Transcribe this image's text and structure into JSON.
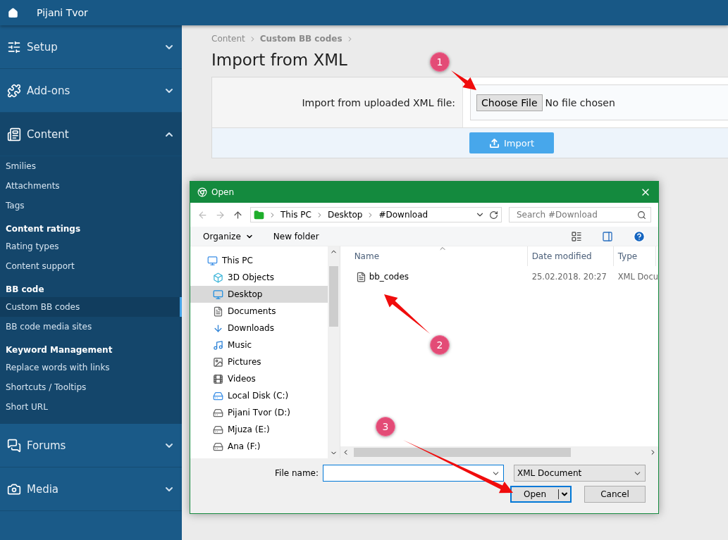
{
  "topbar": {
    "title": "Pijani Tvor"
  },
  "sidebar": {
    "sections": [
      {
        "label": "Setup",
        "expanded": false
      },
      {
        "label": "Add-ons",
        "expanded": false
      },
      {
        "label": "Content",
        "expanded": true,
        "groups": [
          {
            "items": [
              {
                "label": "Smilies",
                "selected": false
              },
              {
                "label": "Attachments",
                "selected": false
              },
              {
                "label": "Tags",
                "selected": false
              }
            ]
          },
          {
            "heading": "Content ratings",
            "items": [
              {
                "label": "Rating types",
                "selected": false
              },
              {
                "label": "Content support",
                "selected": false
              }
            ]
          },
          {
            "heading": "BB code",
            "items": [
              {
                "label": "Custom BB codes",
                "selected": true
              },
              {
                "label": "BB code media sites",
                "selected": false
              }
            ]
          },
          {
            "heading": "Keyword Management",
            "items": [
              {
                "label": "Replace words with links",
                "selected": false
              },
              {
                "label": "Shortcuts / Tooltips",
                "selected": false
              },
              {
                "label": "Short URL",
                "selected": false
              }
            ]
          }
        ]
      },
      {
        "label": "Forums",
        "expanded": false
      },
      {
        "label": "Media",
        "expanded": false
      }
    ]
  },
  "breadcrumb": [
    "Content",
    "Custom BB codes"
  ],
  "page_title": "Import from XML",
  "form": {
    "label": "Import from uploaded XML file:",
    "choose_button": "Choose File",
    "file_status": "No file chosen",
    "submit": "Import"
  },
  "dialog": {
    "title": "Open",
    "path": [
      "This PC",
      "Desktop",
      "#Download"
    ],
    "search_placeholder": "Search #Download",
    "toolbar": [
      "Organize",
      "New folder"
    ],
    "nav": [
      {
        "label": "This PC",
        "selected": false,
        "children": [
          {
            "label": "3D Objects",
            "selected": false
          },
          {
            "label": "Desktop",
            "selected": true
          },
          {
            "label": "Documents",
            "selected": false
          },
          {
            "label": "Downloads",
            "selected": false
          },
          {
            "label": "Music",
            "selected": false
          },
          {
            "label": "Pictures",
            "selected": false
          },
          {
            "label": "Videos",
            "selected": false
          },
          {
            "label": "Local Disk (C:)",
            "selected": false
          },
          {
            "label": "Pijani Tvor (D:)",
            "selected": false
          },
          {
            "label": "Mjuza (E:)",
            "selected": false
          },
          {
            "label": "Ana (F:)",
            "selected": false
          }
        ]
      }
    ],
    "columns": [
      "Name",
      "Date modified",
      "Type"
    ],
    "files": [
      {
        "name": "bb_codes",
        "date": "25.02.2018. 20:27",
        "type": "XML Docu",
        "selected": false
      }
    ],
    "file_name_label": "File name:",
    "file_type": "XML Document",
    "open_button": "Open",
    "cancel_button": "Cancel"
  },
  "annotations": [
    {
      "number": "1"
    },
    {
      "number": "2"
    },
    {
      "number": "3"
    }
  ]
}
